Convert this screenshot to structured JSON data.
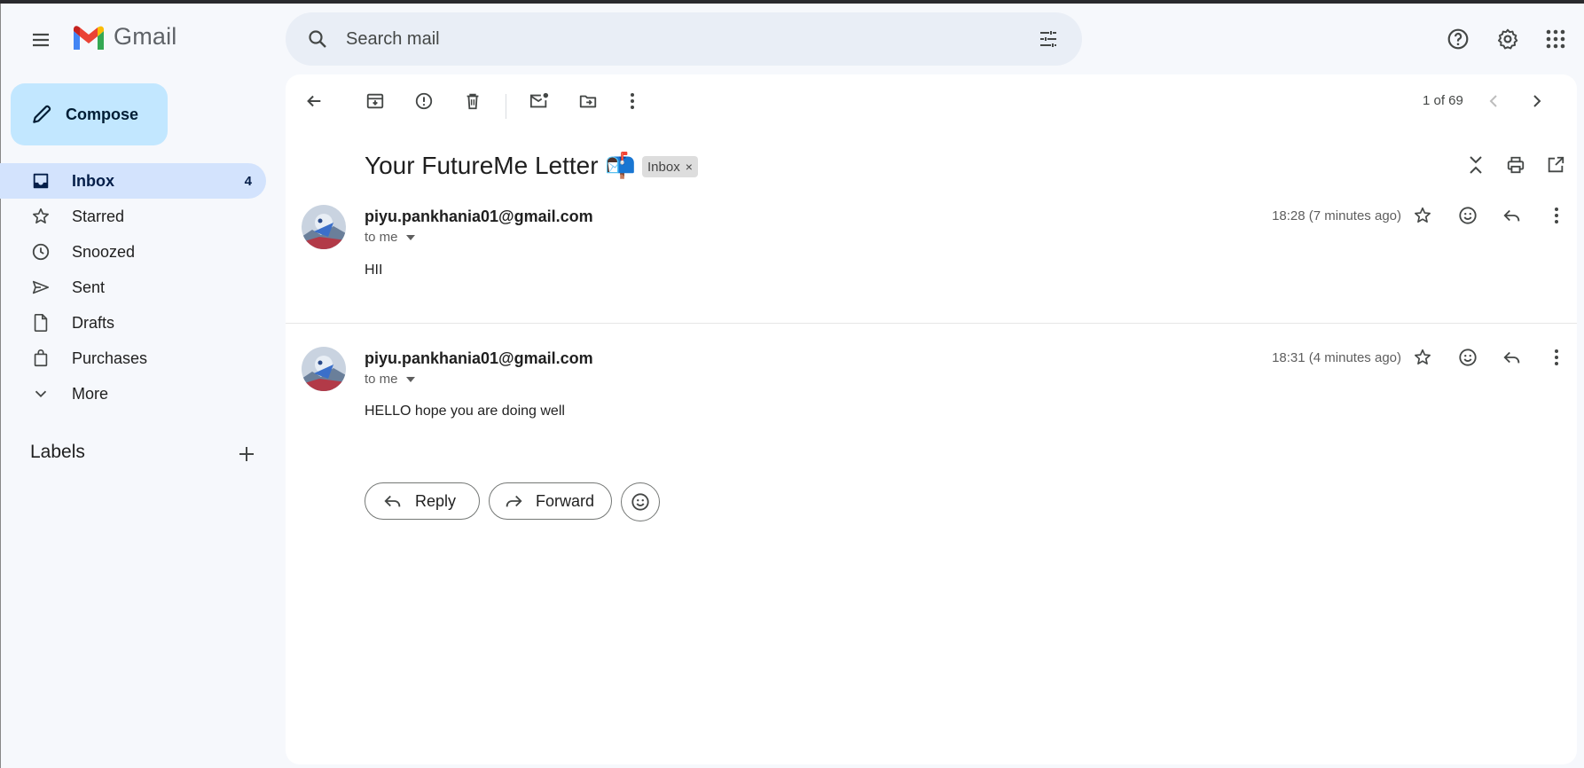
{
  "app": {
    "name": "Gmail",
    "colors": {
      "compose_bg": "#c2e7ff",
      "active_nav_bg": "#d3e3fd",
      "search_bg": "#e9eef6",
      "page_bg": "#f6f8fc"
    }
  },
  "search": {
    "placeholder": "Search mail"
  },
  "compose": {
    "label": "Compose"
  },
  "sidebar": {
    "items": [
      {
        "label": "Inbox",
        "count": "4",
        "icon": "inbox-icon",
        "active": true
      },
      {
        "label": "Starred",
        "count": "",
        "icon": "star-icon"
      },
      {
        "label": "Snoozed",
        "count": "",
        "icon": "clock-icon"
      },
      {
        "label": "Sent",
        "count": "",
        "icon": "send-icon"
      },
      {
        "label": "Drafts",
        "count": "",
        "icon": "draft-icon"
      },
      {
        "label": "Purchases",
        "count": "",
        "icon": "shopping-bag-icon"
      },
      {
        "label": "More",
        "count": "",
        "icon": "chevron-down-icon"
      }
    ],
    "labels_heading": "Labels"
  },
  "toolbar": {
    "pager": "1 of 69"
  },
  "thread": {
    "subject": "Your FutureMe Letter 📬",
    "label_chip": "Inbox",
    "chip_close": "×",
    "messages": [
      {
        "sender": "piyu.pankhania01@gmail.com",
        "recipient": "to me",
        "time": "18:28 (7 minutes ago)",
        "body": "HII"
      },
      {
        "sender": "piyu.pankhania01@gmail.com",
        "recipient": "to me",
        "time": "18:31 (4 minutes ago)",
        "body": "HELLO hope you are doing well"
      }
    ],
    "actions": {
      "reply": "Reply",
      "forward": "Forward"
    }
  }
}
